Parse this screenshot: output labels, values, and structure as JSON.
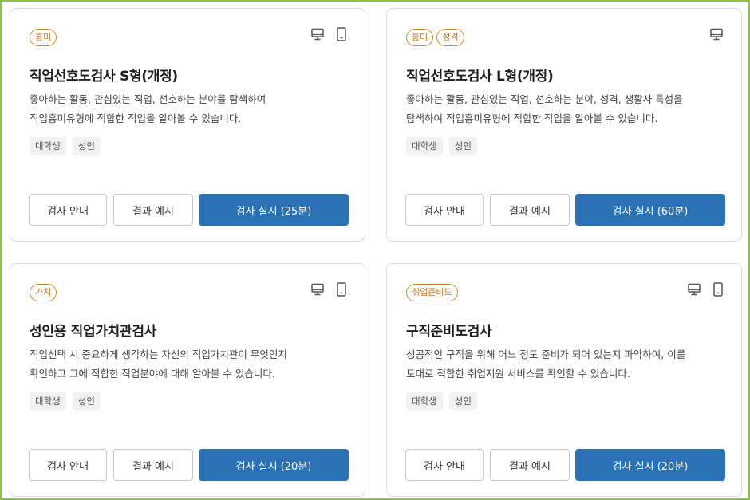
{
  "cards": [
    {
      "tags": [
        "흥미"
      ],
      "devices": [
        "pc",
        "mobile"
      ],
      "title": "직업선호도검사 S형(개정)",
      "description": "좋아하는 활동, 관심있는 직업, 선호하는 분야를 탐색하여\n직업흥미유형에 적합한 직업을 알아볼 수 있습니다.",
      "targets": [
        "대학생",
        "성인"
      ],
      "guide_label": "검사 안내",
      "sample_label": "결과 예시",
      "start_label": "검사 실시 (25분)"
    },
    {
      "tags": [
        "흥미",
        "성격"
      ],
      "devices": [
        "pc"
      ],
      "title": "직업선호도검사 L형(개정)",
      "description": "좋아하는 활동, 관심있는 직업, 선호하는 분야, 성격, 생활사 특성을\n탐색하여 직업흥미유형에 적합한 직업을 알아볼 수 있습니다.",
      "targets": [
        "대학생",
        "성인"
      ],
      "guide_label": "검사 안내",
      "sample_label": "결과 예시",
      "start_label": "검사 실시 (60분)"
    },
    {
      "tags": [
        "가치"
      ],
      "devices": [
        "pc",
        "mobile"
      ],
      "title": "성인용 직업가치관검사",
      "description": "직업선택 시 중요하게 생각하는 자신의 직업가치관이 무엇인지\n확인하고 그에 적합한 직업분야에 대해 알아볼 수 있습니다.",
      "targets": [
        "대학생",
        "성인"
      ],
      "guide_label": "검사 안내",
      "sample_label": "결과 예시",
      "start_label": "검사 실시 (20분)"
    },
    {
      "tags": [
        "취업준비도"
      ],
      "devices": [
        "pc",
        "mobile"
      ],
      "title": "구직준비도검사",
      "description": "성공적인 구직을 위해 어느 정도 준비가 되어 있는지 파악하여, 이를\n토대로 적합한 취업지원 서비스를 확인할 수 있습니다.",
      "targets": [
        "대학생",
        "성인"
      ],
      "guide_label": "검사 안내",
      "sample_label": "결과 예시",
      "start_label": "검사 실시 (20분)"
    }
  ]
}
